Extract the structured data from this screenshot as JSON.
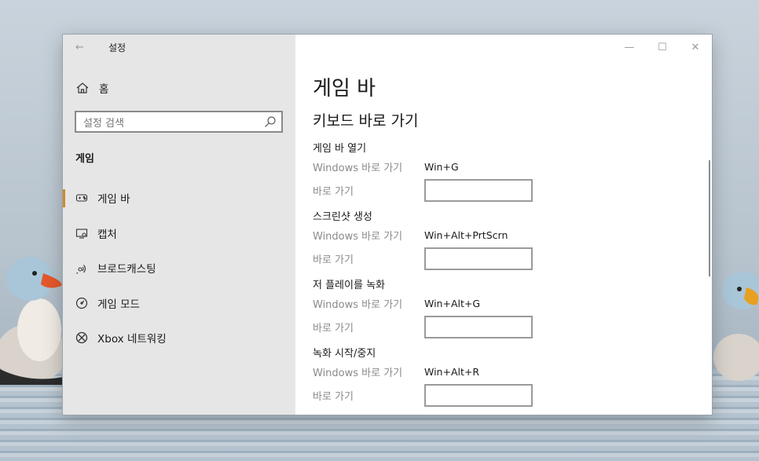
{
  "window": {
    "title": "설정",
    "controls": [
      "minimize",
      "maximize",
      "close"
    ]
  },
  "sidebar": {
    "home_label": "홈",
    "search_placeholder": "설정 검색",
    "section_title": "게임",
    "items": [
      {
        "label": "게임 바",
        "icon": "game-bar-icon",
        "active": true
      },
      {
        "label": "캡처",
        "icon": "capture-icon",
        "active": false
      },
      {
        "label": "브로드캐스팅",
        "icon": "broadcast-icon",
        "active": false
      },
      {
        "label": "게임 모드",
        "icon": "game-mode-icon",
        "active": false
      },
      {
        "label": "Xbox 네트워킹",
        "icon": "xbox-icon",
        "active": false
      }
    ]
  },
  "main": {
    "title": "게임 바",
    "subtitle": "키보드 바로 가기",
    "windows_shortcut_label": "Windows 바로 가기",
    "shortcut_label": "바로 가기",
    "groups": [
      {
        "name": "게임 바 열기",
        "windows_shortcut": "Win+G",
        "custom_shortcut": ""
      },
      {
        "name": "스크린샷 생성",
        "windows_shortcut": "Win+Alt+PrtScrn",
        "custom_shortcut": ""
      },
      {
        "name": "저 플레이를 녹화",
        "windows_shortcut": "Win+Alt+G",
        "custom_shortcut": ""
      },
      {
        "name": "녹화 시작/중지",
        "windows_shortcut": "Win+Alt+R",
        "custom_shortcut": ""
      }
    ]
  },
  "colors": {
    "accent": "#d08a2a",
    "sidebar_bg": "#e6e6e6",
    "content_bg": "#ffffff"
  }
}
